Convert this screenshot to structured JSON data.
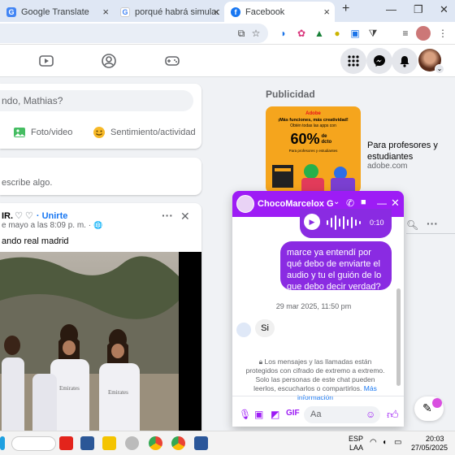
{
  "browser": {
    "tabs": [
      {
        "title": "Google Translate",
        "favicon": "G"
      },
      {
        "title": "porqué habrá simulacro en",
        "favicon": "G"
      },
      {
        "title": "Facebook",
        "favicon": "f"
      }
    ],
    "new_tab": "+",
    "window_controls": {
      "minimize": "—",
      "restore": "❐",
      "close": "✕"
    }
  },
  "composer": {
    "prompt": "ndo, Mathias?",
    "photo_label": "Foto/video",
    "feeling_label": "Sentimiento/actividad",
    "comment_placeholder": "escribe algo."
  },
  "post": {
    "title": "IR.",
    "join": "· Unirte",
    "date": "e mayo a las 8:09 p. m. ·",
    "caption": "ando real madrid"
  },
  "sidebar": {
    "sponsored": "Publicidad",
    "ad": {
      "title": "Para profesores y estudiantes",
      "domain": "adobe.com",
      "image_brand": "Adobe",
      "image_heading": "¡Más funciones, más creatividad!",
      "image_sub": "Obtén todas las apps con",
      "image_big": "60%",
      "image_pct": "de dcto",
      "image_small": "Para profesores y estudiantes"
    }
  },
  "chat": {
    "contact": "ChocoMarcelox G",
    "audio_duration": "0:10",
    "outgoing": "marce ya entendí por qué debo de enviarte el audio y tu el guión de lo que debo decir verdad?",
    "timestamp": "29 mar 2025, 11:50 pm",
    "incoming": "Si",
    "encryption_notice": "Los mensajes y las llamadas están protegidos con cifrado de extremo a extremo. Solo las personas de este chat pueden leerlos, escucharlos o compartirlos.",
    "more_info": "Más información",
    "input_placeholder": "Aa",
    "accent": "#9d1cf5"
  },
  "taskbar": {
    "lang": "ESP",
    "region": "LAA",
    "time": "20:03",
    "date": "27/05/2025"
  }
}
